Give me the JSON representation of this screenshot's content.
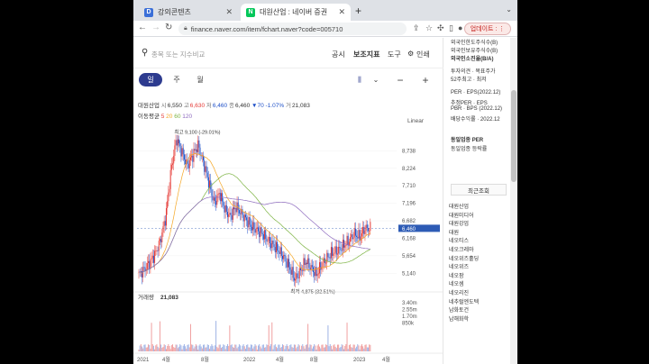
{
  "browser": {
    "tabs": [
      {
        "title": "강의콘텐츠",
        "favicon": "D",
        "favicon_color": "#3b6fd8",
        "active": false
      },
      {
        "title": "대원산업 : 네이버 증권",
        "favicon": "N",
        "favicon_color": "#03c75a",
        "active": true
      }
    ],
    "url": "finance.naver.com/item/fchart.naver?code=005710",
    "update_label": "업데이트 :"
  },
  "search": {
    "placeholder": "종목 또는 지수비교"
  },
  "top_menu": {
    "notice": "공시",
    "indicators": "보조지표",
    "tools": "도구",
    "print": "인쇄"
  },
  "periods": {
    "daily": "일",
    "weekly": "주",
    "monthly": "월"
  },
  "stock": {
    "name": "대원산업",
    "open_label": "시",
    "open": "6,550",
    "high_label": "고",
    "high": "6,630",
    "low_label": "저",
    "low": "6,460",
    "close_label": "종",
    "close": "6,460",
    "change": "▼70",
    "change_pct": "-1.07%",
    "volume_label": "거",
    "volume": "21,083"
  },
  "moving_average": {
    "label": "이동평균",
    "periods": [
      "5",
      "20",
      "60",
      "120"
    ],
    "colors": [
      "#e53935",
      "#f5a623",
      "#7cb342",
      "#8e6bbf"
    ]
  },
  "scale_mode": "Linear",
  "chart_data": {
    "type": "candlestick",
    "price_axis": [
      "8,738",
      "8,224",
      "7,710",
      "7,196",
      "6,682",
      "6,460",
      "6,168",
      "5,654",
      "5,140"
    ],
    "current_price_tag": "6,460",
    "max_annotation": "최고 9,100 (-29.01%)",
    "min_annotation": "최저 4,875 (32.51%)",
    "x_axis": [
      "2021",
      "4월",
      "8월",
      "2022",
      "4월",
      "8월",
      "2023",
      "4월"
    ],
    "close_series": [
      5.1,
      5.25,
      5.45,
      5.7,
      6.1,
      6.8,
      8.2,
      9.1,
      8.7,
      8.3,
      8.6,
      8.9,
      8.4,
      7.8,
      7.2,
      7.5,
      7.0,
      6.8,
      7.1,
      6.9,
      6.7,
      6.5,
      6.4,
      6.3,
      6.1,
      5.95,
      5.8,
      5.6,
      5.3,
      4.95,
      5.2,
      5.5,
      5.3,
      5.1,
      5.4,
      5.6,
      5.75,
      5.8,
      5.95,
      6.1,
      6.3,
      6.2,
      6.45,
      6.46
    ],
    "ma_colors": {
      "ma20": "#f5a623",
      "ma60": "#7cb342",
      "ma120": "#8e6bbf"
    },
    "candle_colors": {
      "up": "#e53935",
      "down": "#1e50c8"
    },
    "volume_label": "거래량",
    "volume_value": "21,083",
    "volume_axis": [
      "3.40m",
      "2.55m",
      "1.70m",
      "850k"
    ]
  },
  "sidebar": {
    "info_lines": [
      "외국인한도주식수(B)",
      "외국인보유주식수(B)",
      "외국인소진율(B/A)",
      "투자의견 · 목표주가",
      "52주최고 · 최저",
      "PER · EPS(2022.12)",
      "추정PER · EPS",
      "PBR · BPS (2022.12)",
      "배당수익률 · 2022.12",
      "동일업종 PER",
      "동일업종 등락률"
    ],
    "recent_title": "최근조회",
    "recent_items": [
      "대원산업",
      "대원미디어",
      "대원강업",
      "대원",
      "네오티스",
      "네오크레마",
      "네오위즈홀딩",
      "네오위즈",
      "네오팜",
      "네오셈",
      "네오리진",
      "네추럴엔도텍",
      "남화토건",
      "남해화학"
    ]
  }
}
